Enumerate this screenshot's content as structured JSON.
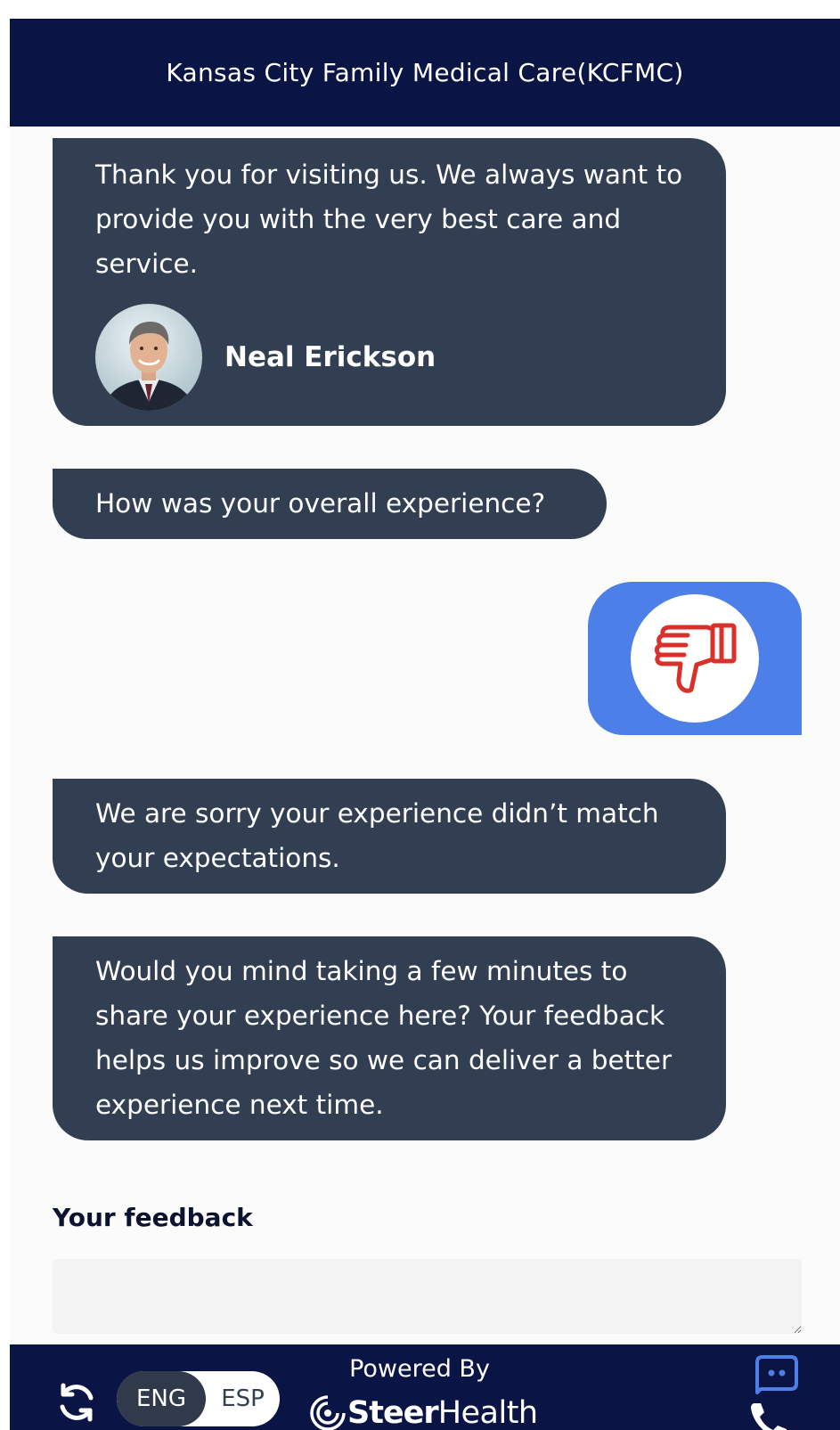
{
  "header": {
    "title": "Kansas City Family Medical Care(KCFMC)"
  },
  "messages": {
    "welcome": "Thank you for visiting us. We always want to provide you with the very best care and service.",
    "sender_name": "Neal Erickson",
    "question": "How was your overall experience?",
    "user_reply_icon": "thumbs-down-icon",
    "apology": "We are sorry your experience didn’t match your expectations.",
    "request": "Would you mind taking a few minutes to share your experience here? Your feedback helps us improve so we can deliver a better experience next time."
  },
  "feedback": {
    "label": "Your feedback",
    "value": ""
  },
  "footer": {
    "lang_eng": "ENG",
    "lang_esp": "ESP",
    "selected_lang": "ENG",
    "powered_by": "Powered By",
    "brand_strong": "Steer",
    "brand_light": "Health"
  },
  "colors": {
    "header_bg": "#0b1545",
    "bubble_bg": "#323e52",
    "reply_bg": "#4c7fe8",
    "thumb_icon": "#d9302c"
  }
}
